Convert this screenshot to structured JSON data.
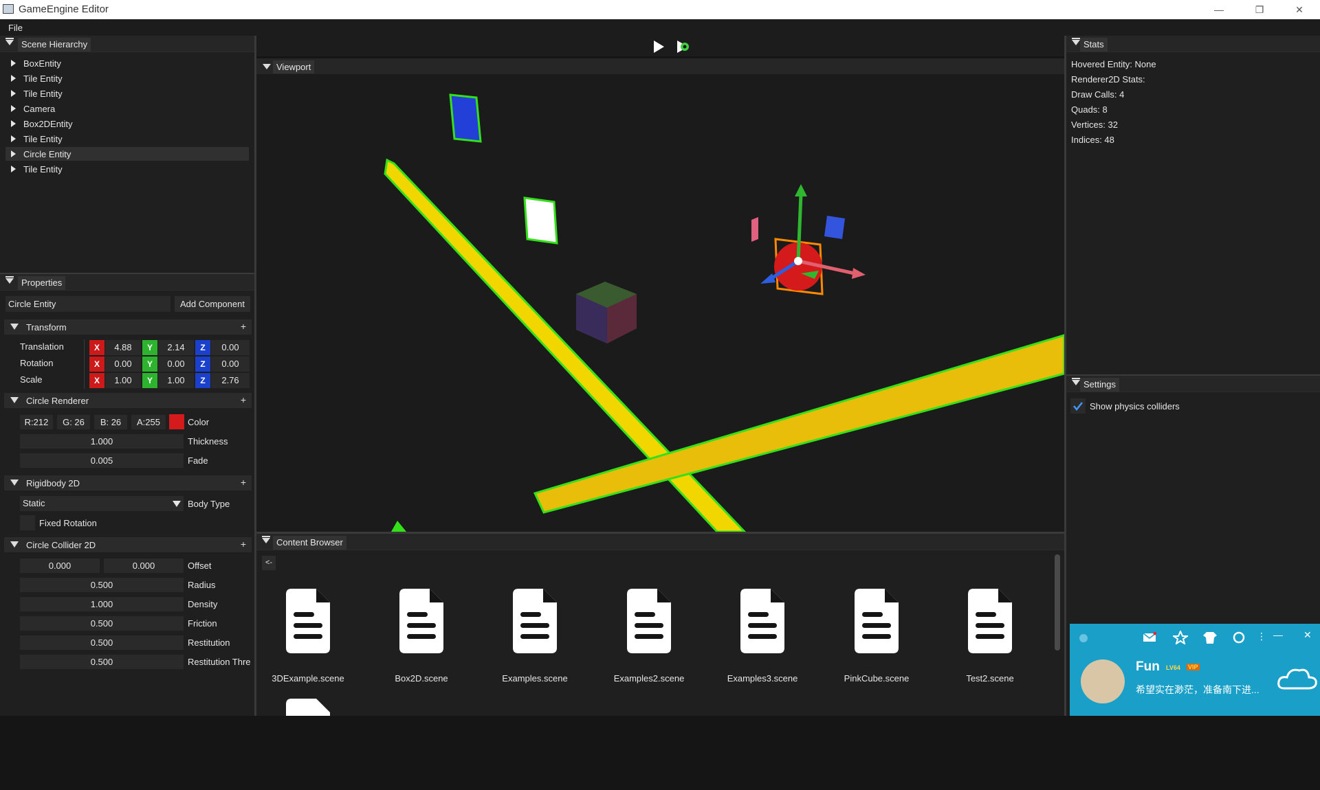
{
  "window": {
    "title": "GameEngine Editor",
    "minimize": "—",
    "restore": "❐",
    "close": "✕"
  },
  "menu": {
    "file": "File"
  },
  "toolbar": {
    "play_icon": "play-icon",
    "simulate_icon": "simulate-icon"
  },
  "hierarchy": {
    "title": "Scene Hierarchy",
    "items": [
      {
        "label": "BoxEntity"
      },
      {
        "label": "Tile Entity"
      },
      {
        "label": "Tile Entity"
      },
      {
        "label": "Camera"
      },
      {
        "label": "Box2DEntity"
      },
      {
        "label": "Tile Entity"
      },
      {
        "label": "Circle Entity",
        "selected": true
      },
      {
        "label": "Tile Entity"
      }
    ]
  },
  "properties": {
    "title": "Properties",
    "entity_name": "Circle Entity",
    "add_component": "Add Component",
    "transform": {
      "title": "Transform",
      "plus": "+",
      "translation_label": "Translation",
      "rotation_label": "Rotation",
      "scale_label": "Scale",
      "axis_x": "X",
      "axis_y": "Y",
      "axis_z": "Z",
      "translation": [
        "4.88",
        "2.14",
        "0.00"
      ],
      "rotation": [
        "0.00",
        "0.00",
        "0.00"
      ],
      "scale": [
        "1.00",
        "1.00",
        "2.76"
      ]
    },
    "circle_renderer": {
      "title": "Circle Renderer",
      "plus": "+",
      "r": "R:212",
      "g": "G: 26",
      "b": "B: 26",
      "a": "A:255",
      "color_swatch": "#d41a1a",
      "color_label": "Color",
      "thickness": "1.000",
      "thickness_label": "Thickness",
      "fade": "0.005",
      "fade_label": "Fade"
    },
    "rigidbody": {
      "title": "Rigidbody 2D",
      "plus": "+",
      "body_type": "Static",
      "body_type_label": "Body Type",
      "fixed_rotation_label": "Fixed Rotation"
    },
    "circle_collider": {
      "title": "Circle Collider 2D",
      "plus": "+",
      "offset_x": "0.000",
      "offset_y": "0.000",
      "offset_label": "Offset",
      "radius": "0.500",
      "radius_label": "Radius",
      "density": "1.000",
      "density_label": "Density",
      "friction": "0.500",
      "friction_label": "Friction",
      "restitution": "0.500",
      "restitution_label": "Restitution",
      "restitution_threshold": "0.500",
      "restitution_threshold_label": "Restitution Thre"
    }
  },
  "viewport": {
    "title": "Viewport"
  },
  "content_browser": {
    "title": "Content Browser",
    "back": "<-",
    "files": [
      "3DExample.scene",
      "Box2D.scene",
      "Examples.scene",
      "Examples2.scene",
      "Examples3.scene",
      "PinkCube.scene",
      "Test2.scene"
    ]
  },
  "stats": {
    "title": "Stats",
    "hovered": "Hovered Entity: None",
    "renderer": "Renderer2D Stats:",
    "draw_calls": "Draw Calls: 4",
    "quads": "Quads: 8",
    "vertices": "Vertices: 32",
    "indices": "Indices: 48"
  },
  "settings": {
    "title": "Settings",
    "show_colliders": "Show physics colliders",
    "show_colliders_checked": true
  },
  "notification": {
    "name": "Fun",
    "level": "LV64",
    "vip": "VIP",
    "message": "希望实在渺茫，准备南下进..."
  },
  "colors": {
    "accent_yellow": "#f2d600",
    "collider_green": "#33e01a",
    "selection_orange": "#ff8a00",
    "checkbox_blue": "#4296fa"
  }
}
